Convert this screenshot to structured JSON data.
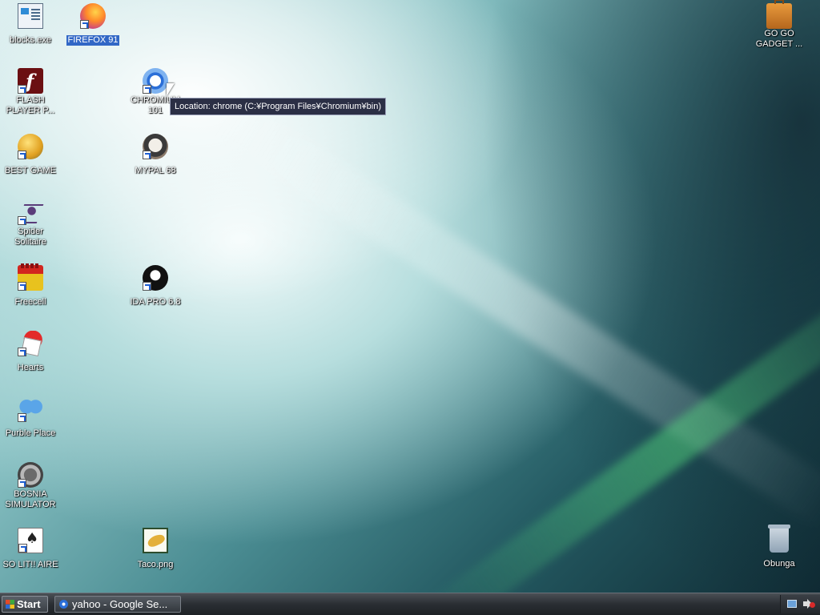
{
  "desktop": {
    "icons": [
      {
        "label": "blocks.exe"
      },
      {
        "label": "FIREFOX 91"
      },
      {
        "label": "FLASH PLAYER P..."
      },
      {
        "label": "CHROMIUM 101"
      },
      {
        "label": "BEST GAME"
      },
      {
        "label": "MYPAL 68"
      },
      {
        "label": "Spider Solitaire"
      },
      {
        "label": "Freecell"
      },
      {
        "label": "IDA PRO 6.8"
      },
      {
        "label": "Hearts"
      },
      {
        "label": "Purble Place"
      },
      {
        "label": "BOSNIA SIMULATOR"
      },
      {
        "label": "SO LIT!! AIRE"
      },
      {
        "label": "Taco.png"
      },
      {
        "label": "GO GO GADGET ..."
      },
      {
        "label": "Obunga"
      }
    ]
  },
  "tooltip": {
    "text": "Location: chrome (C:¥Program Files¥Chromium¥bin)"
  },
  "taskbar": {
    "start_label": "Start",
    "tasks": [
      {
        "label": "yahoo - Google Se..."
      }
    ]
  },
  "colors": {
    "selection": "#3167c6",
    "taskbar": "#2a2e33",
    "tooltip_bg": "#2b2f45"
  }
}
